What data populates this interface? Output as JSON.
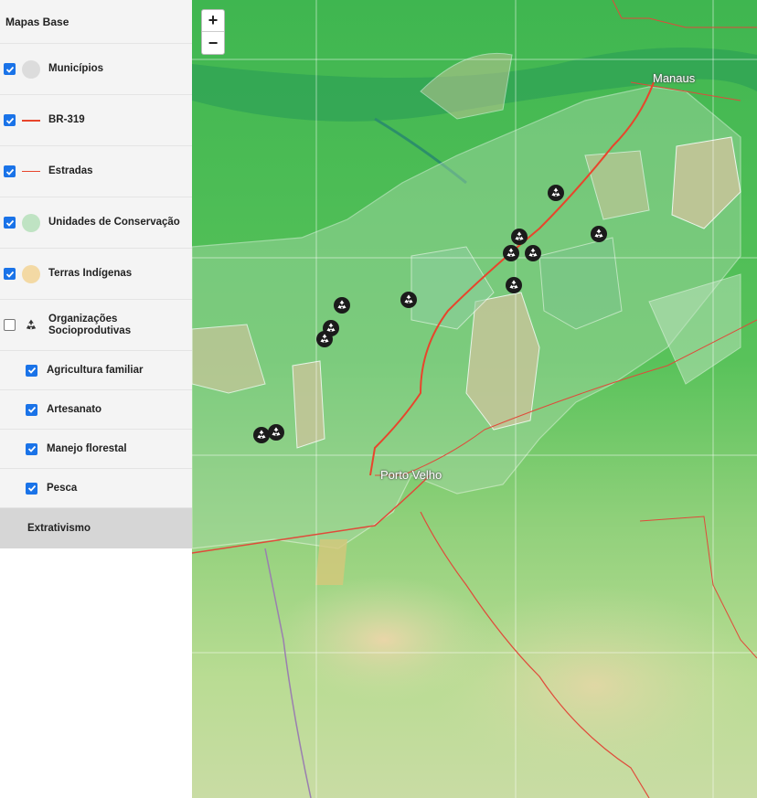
{
  "panel": {
    "title": "Mapas Base",
    "layers": [
      {
        "label": "Municípios",
        "checked": true,
        "symbol": "circle-grey-icon",
        "color": "#dcdcdc"
      },
      {
        "label": "BR-319",
        "checked": true,
        "symbol": "thick-red-line-icon",
        "color": "#e8452c"
      },
      {
        "label": "Estradas",
        "checked": true,
        "symbol": "thin-red-line-icon",
        "color": "#e8452c"
      },
      {
        "label": "Unidades de Conservação",
        "checked": true,
        "symbol": "circle-green-icon",
        "color": "#bfe3c3"
      },
      {
        "label": "Terras Indígenas",
        "checked": true,
        "symbol": "circle-tan-icon",
        "color": "#f3d9a4"
      },
      {
        "label": "Organizações Socioprodutivas",
        "checked": false,
        "symbol": "recycle-icon",
        "color": "#333333"
      }
    ],
    "sublayers": [
      {
        "label": "Agricultura familiar",
        "checked": true
      },
      {
        "label": "Artesanato",
        "checked": true
      },
      {
        "label": "Manejo florestal",
        "checked": true
      },
      {
        "label": "Pesca",
        "checked": true
      }
    ],
    "group_button": "Extrativismo"
  },
  "map": {
    "zoom_in": "+",
    "zoom_out": "−",
    "cities": [
      {
        "name": "Manaus"
      },
      {
        "name": "Porto Velho"
      }
    ]
  }
}
